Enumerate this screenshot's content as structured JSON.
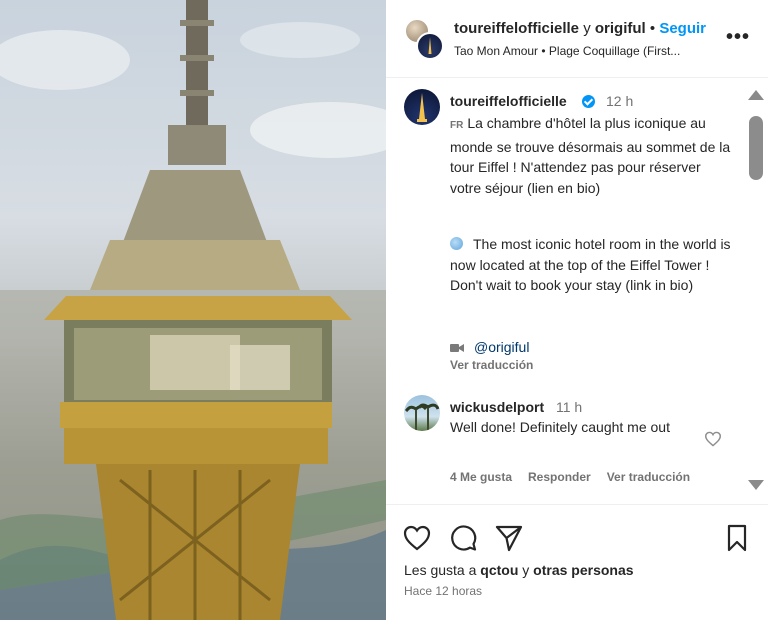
{
  "header": {
    "username": "toureiffelofficielle",
    "joiner": "y",
    "collab_user": "origiful",
    "dot": "•",
    "follow_label": "Seguir",
    "audio": "Tao Mon Amour • Plage Coquillage (First..."
  },
  "caption": {
    "username": "toureiffelofficielle",
    "time": "12 h",
    "lang_tag": "FR",
    "fr_text": "La chambre d'hôtel la plus iconique au monde se trouve désormais au sommet de la tour Eiffel ! N'attendez pas pour réserver votre séjour (lien en bio)",
    "en_text": "The most iconic hotel room in the world is now located at the top of the Eiffel Tower ! Don't wait to book your stay (link in bio)",
    "mention": "@origiful",
    "see_translation": "Ver traducción"
  },
  "comment": {
    "username": "wickusdelport",
    "time": "11 h",
    "text": "Well done! Definitely caught me out",
    "likes": "4 Me gusta",
    "reply": "Responder",
    "see_translation": "Ver traducción"
  },
  "footer": {
    "likes_prefix": "Les gusta a",
    "likes_user": "qctou",
    "likes_joiner": "y",
    "likes_others": "otras personas",
    "time_ago": "Hace 12 horas"
  },
  "icons": {
    "more": "more-options-icon",
    "like": "heart-icon",
    "comment": "comment-icon",
    "share": "paper-plane-icon",
    "save": "bookmark-icon"
  },
  "colors": {
    "accent": "#0095f6",
    "muted": "#737373",
    "text": "#262626"
  }
}
